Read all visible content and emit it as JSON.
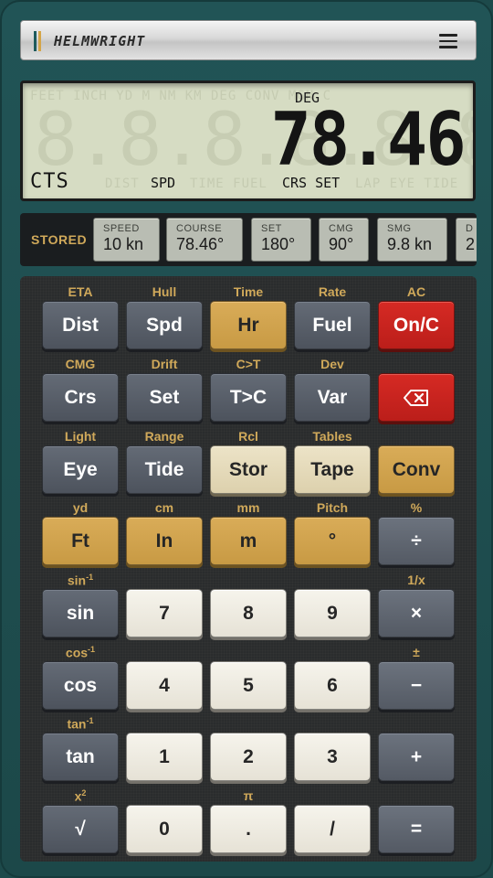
{
  "header": {
    "brand": "HELMWRIGHT",
    "menu_icon": "hamburger-menu-icon"
  },
  "lcd": {
    "mode": "DEG",
    "value": "78.46",
    "ghost_digits": "8.8.8.8.8.8.",
    "function": "CTS",
    "indicator_spd": "SPD",
    "indicator_crs_set": "CRS SET",
    "ghost_top": "FEET INCH YD M NM KM DEG CONV MGN C",
    "ghost_bottom_1": "DIST",
    "ghost_bottom_2": "TIME FUEL",
    "ghost_bottom_3": "LAP EYE TIDE"
  },
  "stored": {
    "label": "STORED",
    "items": [
      {
        "title": "SPEED",
        "value": "10 kn"
      },
      {
        "title": "COURSE",
        "value": "78.46°"
      },
      {
        "title": "SET",
        "value": "180°"
      },
      {
        "title": "CMG",
        "value": "90°"
      },
      {
        "title": "SMG",
        "value": "9.8 kn"
      },
      {
        "title": "D",
        "value": "2"
      }
    ]
  },
  "keys": {
    "r1": {
      "c1": "ETA",
      "k1": "Dist",
      "c2": "Hull",
      "k2": "Spd",
      "c3": "Time",
      "k3": "Hr",
      "c4": "Rate",
      "k4": "Fuel",
      "c5": "AC",
      "k5": "On/C"
    },
    "r2": {
      "c1": "CMG",
      "k1": "Crs",
      "c2": "Drift",
      "k2": "Set",
      "c3": "C>T",
      "k3": "T>C",
      "c4": "Dev",
      "k4": "Var",
      "k5_icon": "backspace-icon"
    },
    "r3": {
      "c1": "Light",
      "k1": "Eye",
      "c2": "Range",
      "k2": "Tide",
      "c3": "Rcl",
      "k3": "Stor",
      "c4": "Tables",
      "k4": "Tape",
      "k5": "Conv"
    },
    "r4": {
      "c1": "yd",
      "k1": "Ft",
      "c2": "cm",
      "k2": "In",
      "c3": "mm",
      "k3": "m",
      "c4": "Pitch",
      "k4": "°",
      "c5": "%",
      "k5": "÷"
    },
    "r5": {
      "c1": "sin",
      "c1_sup": "-1",
      "k1": "sin",
      "k2": "7",
      "k3": "8",
      "k4": "9",
      "c5": "1/x",
      "k5": "×"
    },
    "r6": {
      "c1": "cos",
      "c1_sup": "-1",
      "k1": "cos",
      "k2": "4",
      "k3": "5",
      "k4": "6",
      "c5": "±",
      "k5": "−"
    },
    "r7": {
      "c1": "tan",
      "c1_sup": "-1",
      "k1": "tan",
      "k2": "1",
      "k3": "2",
      "k4": "3",
      "k5": "+"
    },
    "r8": {
      "c1": "x",
      "c1_sup": "2",
      "k1": "√",
      "k2": "0",
      "c3": "π",
      "k3": ".",
      "k4": "/",
      "k5": "="
    }
  },
  "colors": {
    "accent_gold": "#d0a95a",
    "body_teal": "#1d4a4b",
    "clear_red": "#c9231f",
    "lcd_bg": "#d6dcc3"
  }
}
